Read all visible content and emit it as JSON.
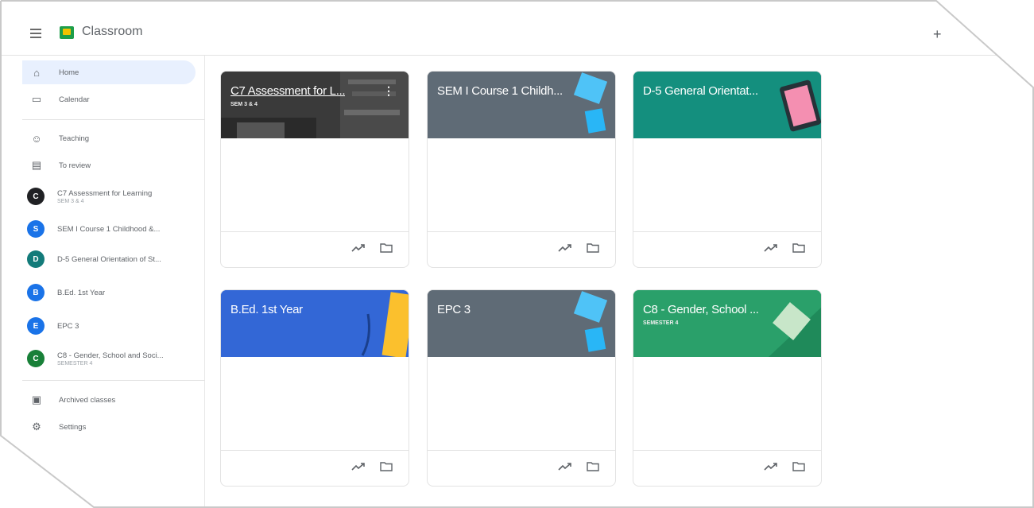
{
  "app": {
    "title": "Classroom",
    "colors": {
      "brand": "#1e9e4a",
      "active_nav": "#e8f0fe"
    }
  },
  "sidebar": {
    "main": [
      {
        "label": "Home",
        "icon": "home-icon",
        "active": true
      },
      {
        "label": "Calendar",
        "icon": "calendar-icon"
      }
    ],
    "teaching": [
      {
        "label": "Teaching",
        "icon": "people-icon"
      },
      {
        "label": "To review",
        "icon": "folder-check-icon"
      }
    ],
    "classes": [
      {
        "initial": "C",
        "label": "C7 Assessment for Learning",
        "sub": "SEM 3 & 4",
        "color": "#202124"
      },
      {
        "initial": "S",
        "label": "SEM I Course 1 Childhood &...",
        "sub": "",
        "color": "#1a73e8"
      },
      {
        "initial": "D",
        "label": "D-5 General Orientation of St...",
        "sub": "",
        "color": "#137b7a"
      },
      {
        "initial": "B",
        "label": "B.Ed. 1st Year",
        "sub": "",
        "color": "#1a73e8"
      },
      {
        "initial": "E",
        "label": "EPC 3",
        "sub": "",
        "color": "#1a73e8"
      },
      {
        "initial": "C",
        "label": "C8 - Gender, School and Soci...",
        "sub": "SEMESTER 4",
        "color": "#188038"
      }
    ],
    "bottom": [
      {
        "label": "Archived classes",
        "icon": "archive-icon"
      },
      {
        "label": "Settings",
        "icon": "gear-icon"
      }
    ]
  },
  "cards": [
    {
      "title": "C7 Assessment for L...",
      "sub": "SEM 3 & 4",
      "color": "#3c3c3c",
      "underline": true,
      "kebab": "⋮"
    },
    {
      "title": "SEM I Course 1 Childh...",
      "sub": "",
      "color": "#5f6b76"
    },
    {
      "title": "D-5 General Orientat...",
      "sub": "",
      "color": "#148f7e"
    },
    {
      "title": "B.Ed. 1st Year",
      "sub": "",
      "color": "#3367d6"
    },
    {
      "title": "EPC 3",
      "sub": "",
      "color": "#5f6b76"
    },
    {
      "title": "C8 - Gender, School ...",
      "sub": "SEMESTER 4",
      "color": "#2aa06a"
    }
  ]
}
